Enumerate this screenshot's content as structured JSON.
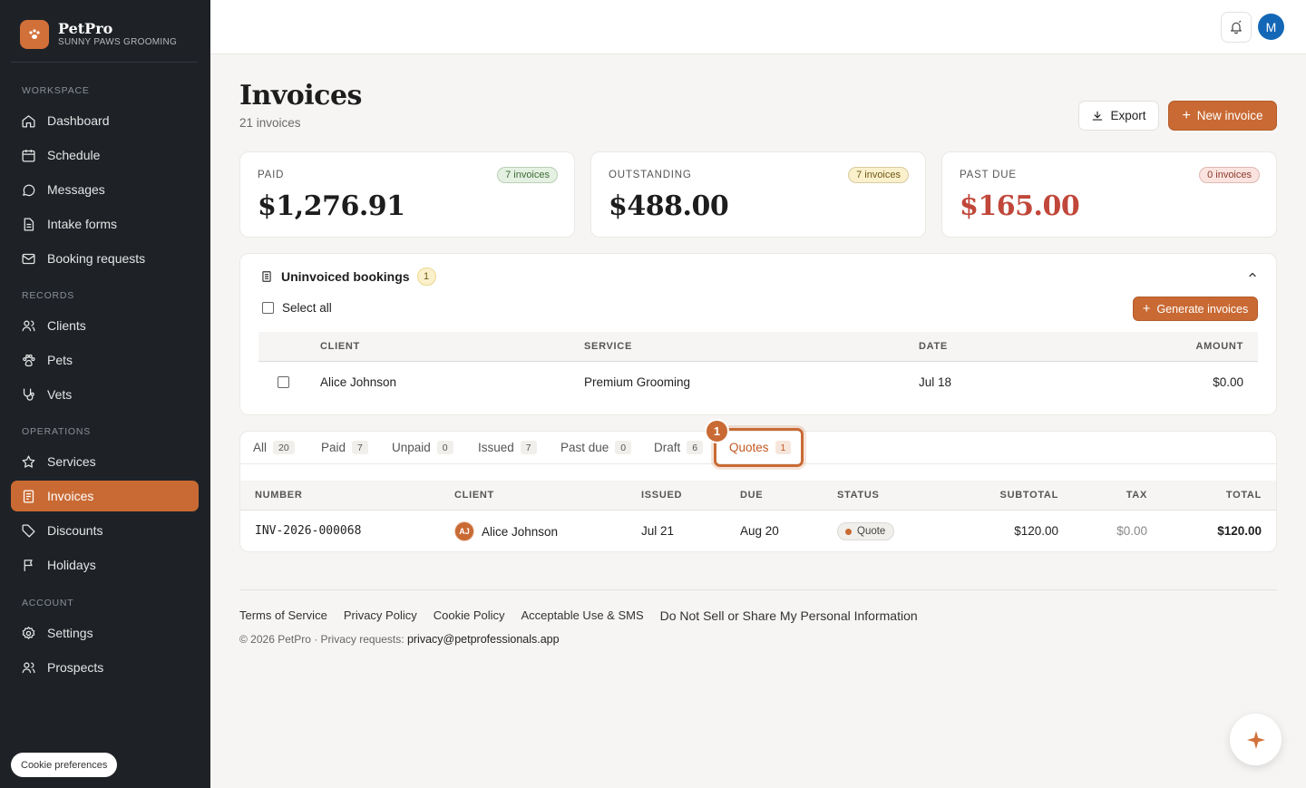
{
  "brand": {
    "name": "PetPro",
    "subtitle": "SUNNY PAWS GROOMING"
  },
  "sidebar": {
    "sections": {
      "workspace": "WORKSPACE",
      "records": "RECORDS",
      "operations": "OPERATIONS",
      "account": "ACCOUNT"
    },
    "items": [
      {
        "label": "Dashboard",
        "icon": "home-icon"
      },
      {
        "label": "Schedule",
        "icon": "calendar-icon"
      },
      {
        "label": "Messages",
        "icon": "chat-icon"
      },
      {
        "label": "Intake forms",
        "icon": "document-icon"
      },
      {
        "label": "Booking requests",
        "icon": "mail-icon"
      },
      {
        "label": "Clients",
        "icon": "users-icon"
      },
      {
        "label": "Pets",
        "icon": "paw-icon"
      },
      {
        "label": "Vets",
        "icon": "stethoscope-icon"
      },
      {
        "label": "Services",
        "icon": "star-icon"
      },
      {
        "label": "Invoices",
        "icon": "invoice-icon",
        "active": true
      },
      {
        "label": "Discounts",
        "icon": "tag-icon"
      },
      {
        "label": "Holidays",
        "icon": "flag-icon"
      },
      {
        "label": "Settings",
        "icon": "gear-icon"
      },
      {
        "label": "Prospects",
        "icon": "users-icon"
      }
    ],
    "cookie_label": "Cookie preferences"
  },
  "topbar": {
    "avatar_initial": "M"
  },
  "page": {
    "title": "Invoices",
    "subtitle": "21 invoices",
    "export_label": "Export",
    "new_label": "New invoice"
  },
  "stats": [
    {
      "label": "PAID",
      "value": "$1,276.91",
      "badge": "7 invoices",
      "badge_bg": "#e4f1e2",
      "badge_fg": "#3d6a35",
      "value_color": "#1d1d1d"
    },
    {
      "label": "OUTSTANDING",
      "value": "$488.00",
      "badge": "7 invoices",
      "badge_bg": "#fbf0cc",
      "badge_fg": "#6d5a18",
      "value_color": "#1d1d1d"
    },
    {
      "label": "PAST DUE",
      "value": "$165.00",
      "badge": "0 invoices",
      "badge_bg": "#fbe3df",
      "badge_fg": "#8a3a2e",
      "value_color": "#c0473a"
    }
  ],
  "uninvoiced": {
    "title": "Uninvoiced bookings",
    "count": "1",
    "select_all": "Select all",
    "generate_label": "Generate invoices",
    "headers": {
      "client": "CLIENT",
      "service": "SERVICE",
      "date": "DATE",
      "amount": "AMOUNT"
    },
    "rows": [
      {
        "client": "Alice Johnson",
        "service": "Premium Grooming",
        "date": "Jul 18",
        "amount": "$0.00"
      }
    ]
  },
  "tabs": [
    {
      "label": "All",
      "count": "20"
    },
    {
      "label": "Paid",
      "count": "7"
    },
    {
      "label": "Unpaid",
      "count": "0"
    },
    {
      "label": "Issued",
      "count": "7"
    },
    {
      "label": "Past due",
      "count": "0"
    },
    {
      "label": "Draft",
      "count": "6"
    },
    {
      "label": "Quotes",
      "count": "1",
      "active": true
    }
  ],
  "highlight_marker": "1",
  "invoices": {
    "headers": {
      "number": "NUMBER",
      "client": "CLIENT",
      "issued": "ISSUED",
      "due": "DUE",
      "status": "STATUS",
      "subtotal": "SUBTOTAL",
      "tax": "TAX",
      "total": "TOTAL"
    },
    "rows": [
      {
        "number": "INV-2026-000068",
        "client_initials": "AJ",
        "client": "Alice Johnson",
        "issued": "Jul 21",
        "due": "Aug 20",
        "status": "Quote",
        "subtotal": "$120.00",
        "tax": "$0.00",
        "total": "$120.00"
      }
    ]
  },
  "footer": {
    "links": [
      "Terms of Service",
      "Privacy Policy",
      "Cookie Policy",
      "Acceptable Use & SMS",
      "Do Not Sell or Share My Personal Information"
    ],
    "copyright": "© 2026 PetPro · Privacy requests:",
    "email": "privacy@petprofessionals.app"
  },
  "colors": {
    "accent": "#c96a34",
    "sidebar_bg": "#1e2227",
    "avatar_bg": "#1467b6"
  }
}
